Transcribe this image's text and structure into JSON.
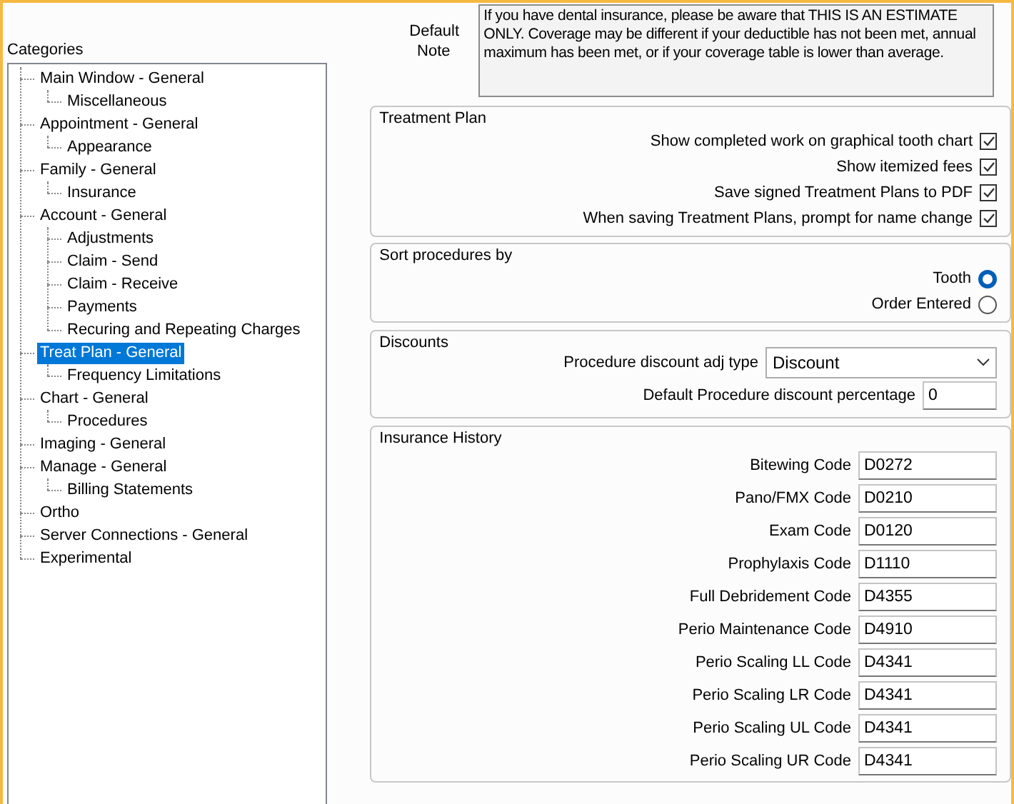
{
  "categories": {
    "label": "Categories",
    "items": [
      {
        "label": "Main Window - General",
        "selected": false,
        "children": [
          {
            "label": "Miscellaneous",
            "selected": false
          }
        ]
      },
      {
        "label": "Appointment - General",
        "selected": false,
        "children": [
          {
            "label": "Appearance",
            "selected": false
          }
        ]
      },
      {
        "label": "Family - General",
        "selected": false,
        "children": [
          {
            "label": "Insurance",
            "selected": false
          }
        ]
      },
      {
        "label": "Account - General",
        "selected": false,
        "children": [
          {
            "label": "Adjustments",
            "selected": false
          },
          {
            "label": "Claim - Send",
            "selected": false
          },
          {
            "label": "Claim - Receive",
            "selected": false
          },
          {
            "label": "Payments",
            "selected": false
          },
          {
            "label": "Recuring and Repeating Charges",
            "selected": false
          }
        ]
      },
      {
        "label": "Treat Plan - General",
        "selected": true,
        "children": [
          {
            "label": "Frequency Limitations",
            "selected": false
          }
        ]
      },
      {
        "label": "Chart - General",
        "selected": false,
        "children": [
          {
            "label": "Procedures",
            "selected": false
          }
        ]
      },
      {
        "label": "Imaging - General",
        "selected": false
      },
      {
        "label": "Manage - General",
        "selected": false,
        "children": [
          {
            "label": "Billing Statements",
            "selected": false
          }
        ]
      },
      {
        "label": "Ortho",
        "selected": false
      },
      {
        "label": "Server Connections - General",
        "selected": false
      },
      {
        "label": "Experimental",
        "selected": false
      }
    ]
  },
  "default_note": {
    "label": "Default Note",
    "value": "If you have dental insurance, please be aware that THIS IS AN ESTIMATE ONLY.  Coverage may be different if your deductible has not been met, annual maximum has been met, or if your coverage table is lower than average."
  },
  "treatment_plan": {
    "title": "Treatment Plan",
    "options": [
      {
        "label": "Show completed work on graphical tooth chart",
        "checked": true
      },
      {
        "label": "Show itemized fees",
        "checked": true
      },
      {
        "label": "Save signed Treatment Plans to PDF",
        "checked": true
      },
      {
        "label": "When saving Treatment Plans, prompt for name change",
        "checked": true
      }
    ]
  },
  "sort_procedures": {
    "title": "Sort procedures by",
    "options": [
      {
        "label": "Tooth",
        "selected": true
      },
      {
        "label": "Order Entered",
        "selected": false
      }
    ]
  },
  "discounts": {
    "title": "Discounts",
    "adj_type": {
      "label": "Procedure discount adj type",
      "value": "Discount"
    },
    "percentage": {
      "label": "Default Procedure discount percentage",
      "value": "0"
    }
  },
  "insurance_history": {
    "title": "Insurance History",
    "codes": [
      {
        "label": "Bitewing Code",
        "value": "D0272"
      },
      {
        "label": "Pano/FMX Code",
        "value": "D0210"
      },
      {
        "label": "Exam Code",
        "value": "D0120"
      },
      {
        "label": "Prophylaxis Code",
        "value": "D1110"
      },
      {
        "label": "Full Debridement Code",
        "value": "D4355"
      },
      {
        "label": "Perio Maintenance Code",
        "value": "D4910"
      },
      {
        "label": "Perio Scaling LL Code",
        "value": "D4341"
      },
      {
        "label": "Perio Scaling LR Code",
        "value": "D4341"
      },
      {
        "label": "Perio Scaling UL Code",
        "value": "D4341"
      },
      {
        "label": "Perio Scaling UR Code",
        "value": "D4341"
      }
    ]
  }
}
